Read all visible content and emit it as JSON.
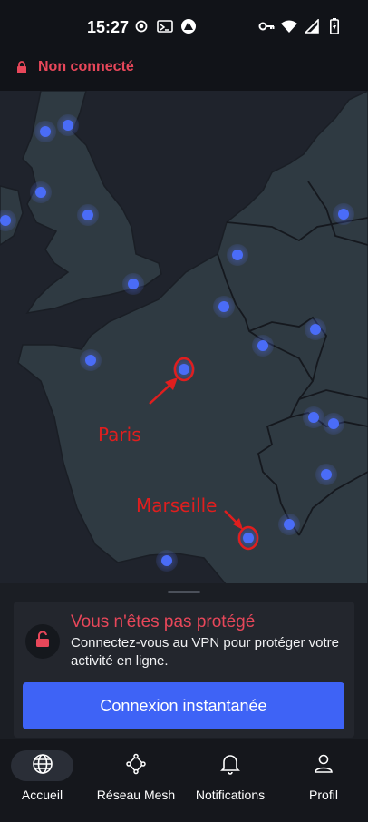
{
  "status_bar": {
    "time": "15:27",
    "left_icons": [
      "record-icon",
      "cast-icon",
      "nordvpn-icon"
    ],
    "right_icons": [
      "vpn-key-icon",
      "wifi-icon",
      "signal-icon",
      "battery-icon"
    ]
  },
  "connection": {
    "status_text": "Non connecté",
    "color": "#e8475a"
  },
  "map": {
    "marker_color": "#4a6cf7",
    "annotations": [
      {
        "label": "Paris",
        "color": "#e01e1e"
      },
      {
        "label": "Marseille",
        "color": "#e01e1e"
      }
    ]
  },
  "card": {
    "title": "Vous n'êtes pas protégé",
    "description": "Connectez-vous au VPN pour protéger votre activité en ligne.",
    "button_label": "Connexion instantanée",
    "button_color": "#3e63f6"
  },
  "nav": {
    "items": [
      {
        "label": "Accueil",
        "icon": "globe-icon",
        "active": true
      },
      {
        "label": "Réseau Mesh",
        "icon": "mesh-network-icon",
        "active": false
      },
      {
        "label": "Notifications",
        "icon": "bell-icon",
        "active": false
      },
      {
        "label": "Profil",
        "icon": "person-icon",
        "active": false
      }
    ]
  }
}
